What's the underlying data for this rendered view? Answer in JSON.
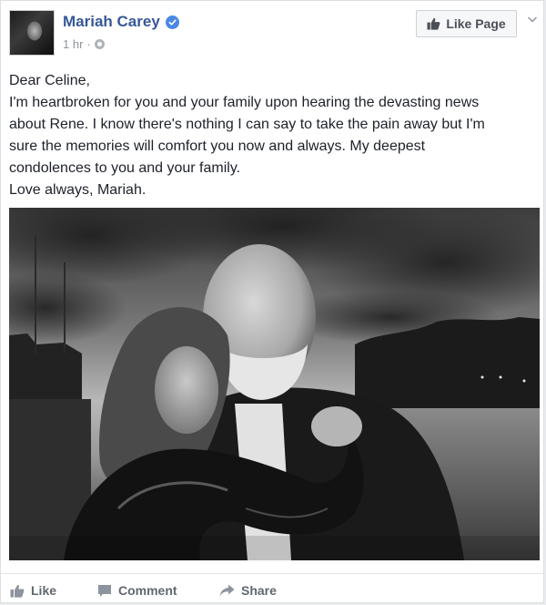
{
  "post": {
    "page_name": "Mariah Carey",
    "timestamp": "1 hr",
    "separator": "·",
    "like_page_label": "Like Page",
    "text_lines": [
      "Dear Celine,",
      "I'm heartbroken for you and your family upon hearing the devasting news",
      "about Rene. I know there's nothing I can say to take the pain away but I'm",
      "sure the memories will comfort you now and always. My deepest",
      "condolences to you and your family.",
      "Love always, Mariah."
    ]
  },
  "actions": {
    "like_label": "Like",
    "comment_label": "Comment",
    "share_label": "Share"
  },
  "icons": {
    "verified": "verified-badge-icon",
    "thumbs_up": "thumbs-up-icon",
    "comment": "comment-icon",
    "share": "share-icon",
    "globe": "globe-icon",
    "chevron": "chevron-down-icon"
  },
  "colors": {
    "link_blue": "#365899",
    "verified_blue": "#4b88e4",
    "meta_gray": "#90949c",
    "action_gray": "#616770"
  }
}
